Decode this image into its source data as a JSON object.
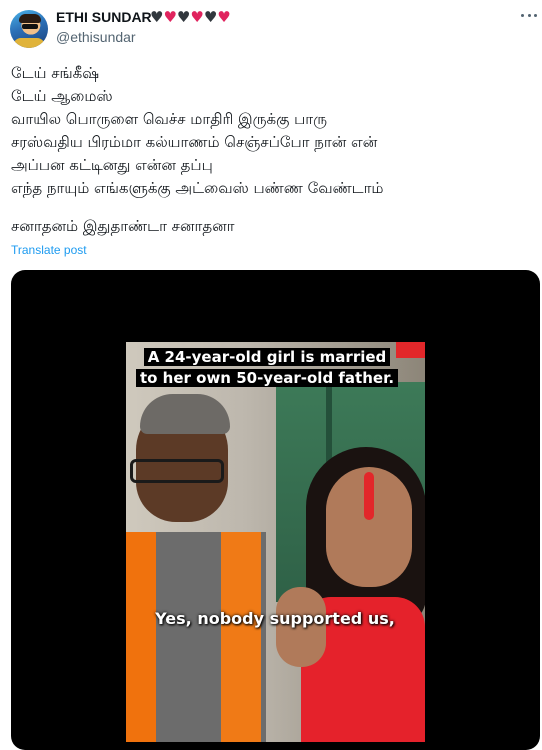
{
  "author": {
    "name": "ETHI SUNDAR",
    "handle": "@ethisundar",
    "hearts": [
      "black",
      "red",
      "black",
      "red",
      "black",
      "red"
    ]
  },
  "menu": {
    "icon": "more-horizontal-icon"
  },
  "tweet": {
    "lines": [
      "டேய் சங்கீஷ்",
      "டேய் ஆமைஸ்",
      "வாயில பொருளை வெச்ச மாதிரி இருக்கு பாரு",
      "சரஸ்வதிய பிரம்மா கல்யாணம் செஞ்சப்போ நான் என்",
      "அப்பன கட்டினது என்ன தப்பு",
      "எந்த நாயும் எங்களுக்கு அட்வைஸ் பண்ண வேண்டாம்",
      "சனாதனம் இதுதாண்டா சனாதனா"
    ],
    "translate_label": "Translate post"
  },
  "video": {
    "caption_line1": "A 24-year-old girl is married",
    "caption_line2": "to her own 50-year-old father.",
    "subtitle": "Yes, nobody supported us,"
  },
  "colors": {
    "link": "#1d9bf0",
    "muted": "#536471",
    "text": "#0f1419",
    "heart_red": "#e0245e",
    "heart_black": "#31373d"
  }
}
